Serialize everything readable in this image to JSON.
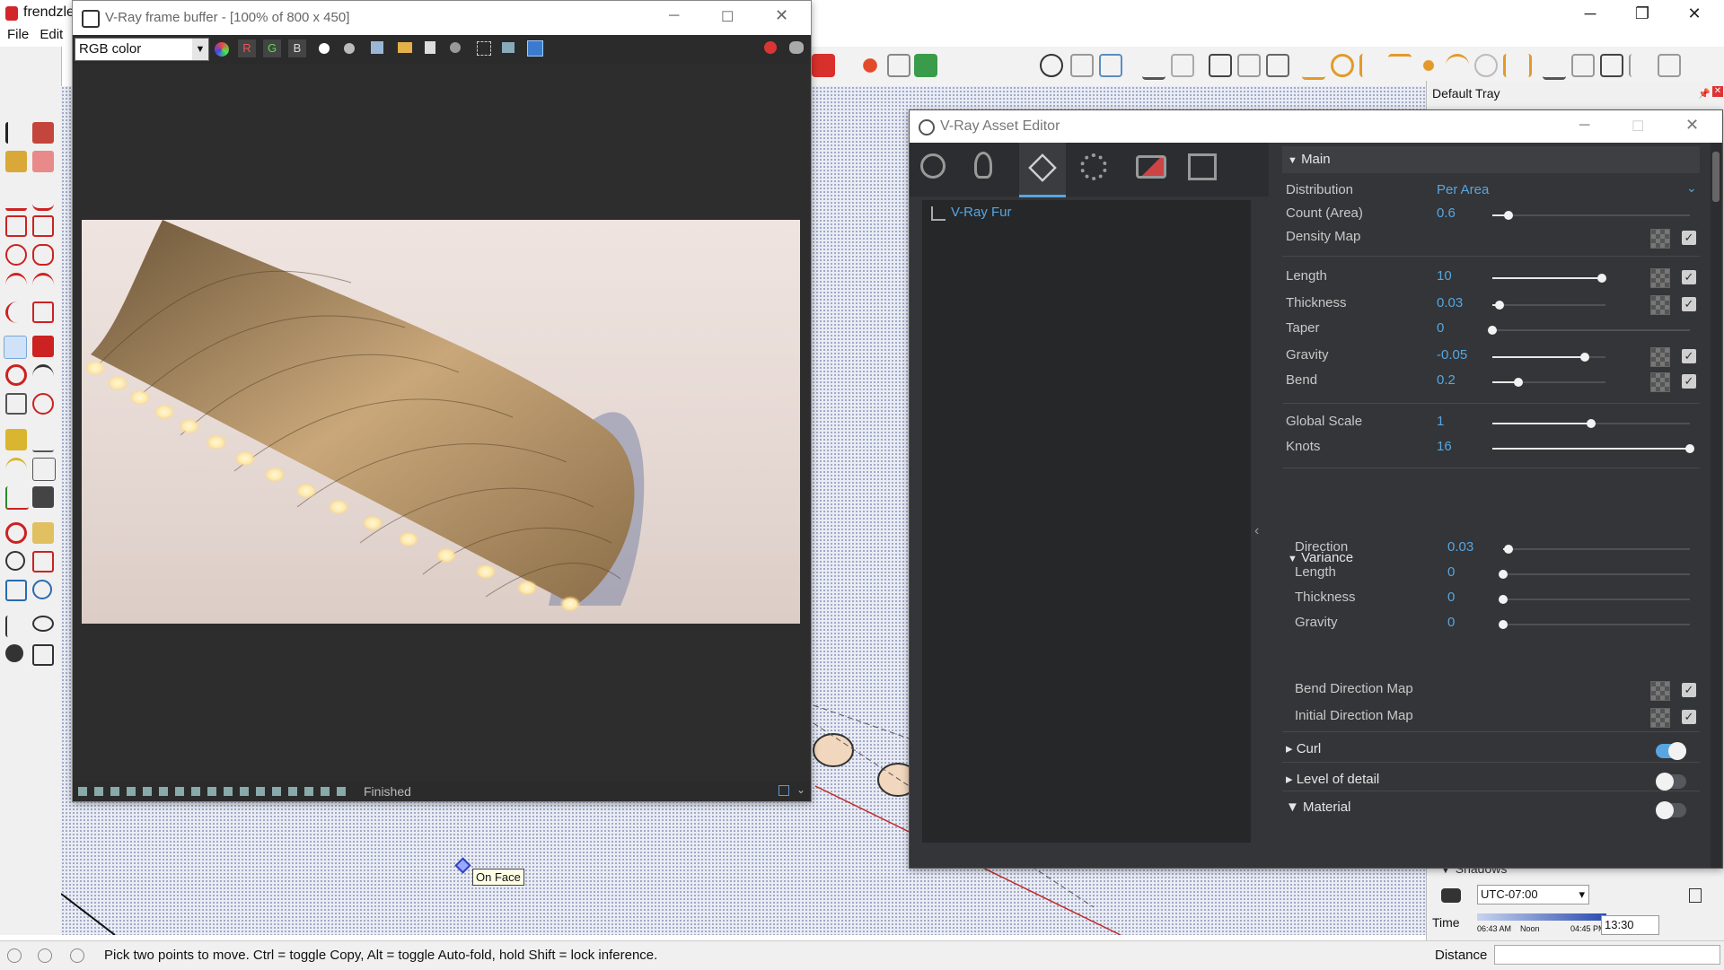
{
  "app": {
    "title": "frendzle",
    "menu": [
      "File",
      "Edit"
    ],
    "window_controls": {
      "minimize": "─",
      "restore": "❐",
      "close": "✕"
    }
  },
  "vfb": {
    "title": "V-Ray frame buffer - [100% of 800 x 450]",
    "channel_select": "RGB color",
    "channel_buttons": [
      "R",
      "G",
      "B"
    ],
    "status": "Finished"
  },
  "asset_editor": {
    "title": "V-Ray Asset Editor",
    "list_items": [
      "V-Ray Fur"
    ],
    "main": {
      "header": "Main",
      "distribution_label": "Distribution",
      "distribution_value": "Per Area",
      "rows": [
        {
          "label": "Count (Area)",
          "value": "0.6",
          "level": 0.08,
          "map": false
        },
        {
          "label": "Density Map",
          "value": "",
          "level": null,
          "map": true
        },
        {
          "label": "Length",
          "value": "10",
          "level": 0.97,
          "map": true
        },
        {
          "label": "Thickness",
          "value": "0.03",
          "level": 0.06,
          "map": true
        },
        {
          "label": "Taper",
          "value": "0",
          "level": 0.0,
          "map": false
        },
        {
          "label": "Gravity",
          "value": "-0.05",
          "level": 0.82,
          "map": true
        },
        {
          "label": "Bend",
          "value": "0.2",
          "level": 0.23,
          "map": true
        },
        {
          "label": "Global Scale",
          "value": "1",
          "level": 0.5,
          "map": false
        },
        {
          "label": "Knots",
          "value": "16",
          "level": 1.0,
          "map": false
        }
      ]
    },
    "variance": {
      "header": "Variance",
      "rows": [
        {
          "label": "Direction",
          "value": "0.03",
          "level": 0.03
        },
        {
          "label": "Length",
          "value": "0",
          "level": 0.0
        },
        {
          "label": "Thickness",
          "value": "0",
          "level": 0.0
        },
        {
          "label": "Gravity",
          "value": "0",
          "level": 0.0
        }
      ],
      "maps": [
        "Bend Direction Map",
        "Initial Direction Map"
      ]
    },
    "collapsed_sections": [
      {
        "label": "Curl",
        "enabled": true
      },
      {
        "label": "Level of detail",
        "enabled": false
      },
      {
        "label": "Material",
        "enabled": false
      }
    ]
  },
  "tray": {
    "title": "Default Tray",
    "shadows_label": "Shadows",
    "timezone": "UTC-07:00",
    "time_label": "Time",
    "time_ticks": [
      "06:43 AM",
      "Noon",
      "04:45 PM"
    ],
    "time_value": "13:30"
  },
  "viewport": {
    "tooltip": "On Face"
  },
  "statusbar": {
    "hint": "Pick two points to move.  Ctrl = toggle Copy, Alt = toggle Auto-fold, hold Shift = lock inference.",
    "distance_label": "Distance"
  },
  "colors": {
    "accent": "#58a6e0",
    "panel_bg": "#333538",
    "vfb_bg": "#2d2d2d"
  }
}
